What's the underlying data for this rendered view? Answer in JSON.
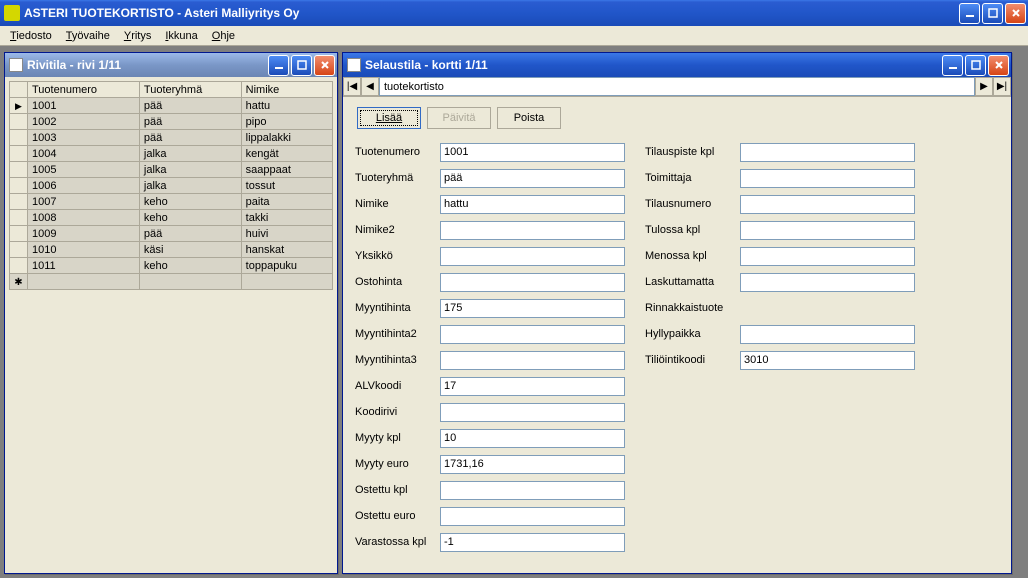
{
  "main": {
    "title": "ASTERI TUOTEKORTISTO - Asteri Malliyritys Oy"
  },
  "menu": {
    "items": [
      {
        "label": "Tiedosto",
        "u": "T"
      },
      {
        "label": "Työvaihe",
        "u": "T"
      },
      {
        "label": "Yritys",
        "u": "Y"
      },
      {
        "label": "Ikkuna",
        "u": "I"
      },
      {
        "label": "Ohje",
        "u": "O"
      }
    ]
  },
  "rivi": {
    "title": "Rivitila - rivi 1/11",
    "columns": [
      "Tuotenumero",
      "Tuoteryhmä",
      "Nimike"
    ],
    "rows": [
      [
        "1001",
        "pää",
        "hattu"
      ],
      [
        "1002",
        "pää",
        "pipo"
      ],
      [
        "1003",
        "pää",
        "lippalakki"
      ],
      [
        "1004",
        "jalka",
        "kengät"
      ],
      [
        "1005",
        "jalka",
        "saappaat"
      ],
      [
        "1006",
        "jalka",
        "tossut"
      ],
      [
        "1007",
        "keho",
        "paita"
      ],
      [
        "1008",
        "keho",
        "takki"
      ],
      [
        "1009",
        "pää",
        "huivi"
      ],
      [
        "1010",
        "käsi",
        "hanskat"
      ],
      [
        "1011",
        "keho",
        "toppapuku"
      ]
    ]
  },
  "sel": {
    "title": "Selaustila - kortti 1/11",
    "nav_field": "tuotekortisto",
    "btn_add": "Lisää",
    "btn_update": "Päivitä",
    "btn_delete": "Poista",
    "left_fields": [
      {
        "label": "Tuotenumero",
        "value": "1001"
      },
      {
        "label": "Tuoteryhmä",
        "value": "pää"
      },
      {
        "label": "Nimike",
        "value": "hattu"
      },
      {
        "label": "Nimike2",
        "value": ""
      },
      {
        "label": "Yksikkö",
        "value": ""
      },
      {
        "label": "Ostohinta",
        "value": ""
      },
      {
        "label": "Myyntihinta",
        "value": "175"
      },
      {
        "label": "Myyntihinta2",
        "value": ""
      },
      {
        "label": "Myyntihinta3",
        "value": ""
      },
      {
        "label": "ALVkoodi",
        "value": "17"
      },
      {
        "label": "Koodirivi",
        "value": ""
      },
      {
        "label": "Myyty kpl",
        "value": "10"
      },
      {
        "label": "Myyty euro",
        "value": "1731,16"
      },
      {
        "label": "Ostettu kpl",
        "value": ""
      },
      {
        "label": "Ostettu euro",
        "value": ""
      },
      {
        "label": "Varastossa kpl",
        "value": "-1"
      }
    ],
    "right_fields": [
      {
        "label": "Tilauspiste kpl",
        "value": ""
      },
      {
        "label": "Toimittaja",
        "value": ""
      },
      {
        "label": "Tilausnumero",
        "value": ""
      },
      {
        "label": "Tulossa kpl",
        "value": ""
      },
      {
        "label": "Menossa kpl",
        "value": ""
      },
      {
        "label": "Laskuttamatta",
        "value": ""
      },
      {
        "label": "Rinnakkaistuote",
        "value": "",
        "noinput": true
      },
      {
        "label": "Hyllypaikka",
        "value": ""
      },
      {
        "label": "Tiliöintikoodi",
        "value": "3010"
      }
    ]
  }
}
